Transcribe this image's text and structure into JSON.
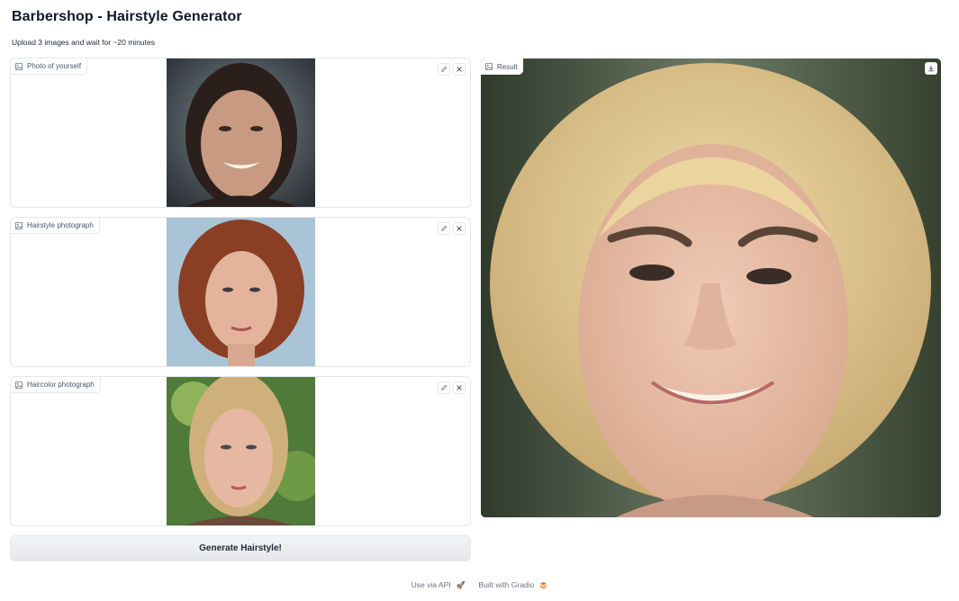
{
  "app": {
    "title": "Barbershop - Hairstyle Generator",
    "subtitle": "Upload 3 images and wait for ~20 minutes"
  },
  "inputs": [
    {
      "label": "Photo of yourself",
      "icon": "image-icon"
    },
    {
      "label": "Hairstyle photograph",
      "icon": "image-icon"
    },
    {
      "label": "Haircolor photograph",
      "icon": "image-icon"
    }
  ],
  "output": {
    "label": "Result",
    "icon": "image-icon"
  },
  "actions": {
    "generate_label": "Generate Hairstyle!"
  },
  "footer": {
    "api_label": "Use via API",
    "separator": "·",
    "built_label": "Built with Gradio"
  },
  "colors": {
    "accent": "#f97316",
    "border": "#e5e7eb",
    "button_bg": "#e5e7eb"
  }
}
